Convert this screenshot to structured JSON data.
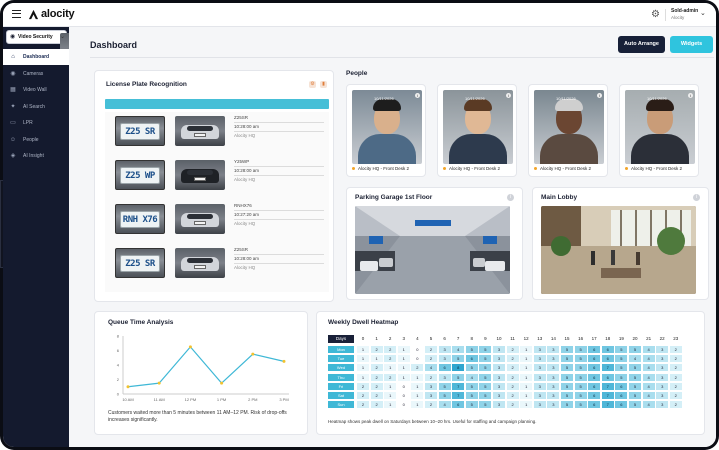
{
  "app": {
    "brand": "alocity"
  },
  "user": {
    "name": "Sold-admin",
    "org": "Alocity"
  },
  "workspace": {
    "label": "Video Security"
  },
  "nav": [
    {
      "label": "Dashboard",
      "icon": "home-icon",
      "glyph": "⌂",
      "active": true
    },
    {
      "label": "Cameras",
      "icon": "camera-icon",
      "glyph": "◉",
      "active": false
    },
    {
      "label": "Video Wall",
      "icon": "grid-icon",
      "glyph": "▦",
      "active": false
    },
    {
      "label": "AI Search",
      "icon": "sparkle-search-icon",
      "glyph": "✦",
      "active": false
    },
    {
      "label": "LPR",
      "icon": "car-icon",
      "glyph": "▭",
      "active": false
    },
    {
      "label": "People",
      "icon": "people-icon",
      "glyph": "☺",
      "active": false
    },
    {
      "label": "AI Insight",
      "icon": "insight-icon",
      "glyph": "◈",
      "active": false
    }
  ],
  "header": {
    "title": "Dashboard",
    "auto_arrange": "Auto Arrange",
    "widgets": "Widgets"
  },
  "lpr": {
    "title": "License Plate Recognition",
    "rows": [
      {
        "plate": "Z25 SR",
        "value": "Z25SR",
        "time": "10:28:00 am",
        "site": "Alocity HQ",
        "car": "light"
      },
      {
        "plate": "Z25 WP",
        "value": "Y25WP",
        "time": "10:28:00 am",
        "site": "Alocity HQ",
        "car": "dark"
      },
      {
        "plate": "RNH X76",
        "value": "RNHX76",
        "time": "10:27:20 am",
        "site": "Alocity HQ",
        "car": "light"
      },
      {
        "plate": "Z25 SR",
        "value": "Z25SR",
        "time": "10:28:00 am",
        "site": "Alocity HQ",
        "car": "light"
      }
    ]
  },
  "people": {
    "title": "People",
    "cards": [
      {
        "timestamp": "10/11/2026",
        "label": "Alocity HQ - Front Desk 2",
        "bg": "#7c8a96",
        "skin": "#d9b08c",
        "hair": "#1d1d1d",
        "shirt": "#4d6a86"
      },
      {
        "timestamp": "10/11/2026",
        "label": "Alocity HQ - Front Desk 2",
        "bg": "#8b949a",
        "skin": "#e0b895",
        "hair": "#5a3a24",
        "shirt": "#2d3a4d"
      },
      {
        "timestamp": "10/11/2026",
        "label": "Alocity HQ - Front Desk 2",
        "bg": "#7a8790",
        "skin": "#6b4632",
        "hair": "#cfcfcf",
        "shirt": "#5a4a40"
      },
      {
        "timestamp": "10/11/2026",
        "label": "Alocity HQ - Front Desk 2",
        "bg": "#a6adb0",
        "skin": "#c99c78",
        "hair": "#2a1d17",
        "shirt": "#2b2f38"
      }
    ]
  },
  "cameras": [
    {
      "title": "Parking Garage 1st Floor"
    },
    {
      "title": "Main Lobby"
    }
  ],
  "queue": {
    "title": "Queue Time Analysis",
    "note": "Customers waited more than 5 minutes between 11 AM–12 PM. Risk of drop-offs increases significantly.",
    "chart_data": {
      "type": "line",
      "categories": [
        "10 AM",
        "11 AM",
        "12 PM",
        "1 PM",
        "2 PM",
        "3 PM"
      ],
      "values": [
        1,
        1.5,
        6.5,
        1.5,
        5.5,
        4.5
      ],
      "yticks": [
        "0",
        "2",
        "4",
        "6",
        "8"
      ],
      "ylim": [
        0,
        8
      ],
      "color": "#3fb8d6"
    }
  },
  "heatmap": {
    "title": "Weekly Dwell Heatmap",
    "days_label": "Days",
    "hours": [
      "0",
      "1",
      "2",
      "3",
      "4",
      "5",
      "6",
      "7",
      "8",
      "9",
      "10",
      "11",
      "12",
      "13",
      "14",
      "15",
      "16",
      "17",
      "18",
      "19",
      "20",
      "21",
      "22",
      "23"
    ],
    "note": "Heatmap shows peak dwell on Saturdays between 10–20 hrs. Useful for staffing and campaign planning.",
    "chart_data": {
      "type": "heatmap",
      "rows": [
        "Mon",
        "Tue",
        "Wed",
        "Thu",
        "Fri",
        "Sat",
        "Sun"
      ],
      "values": [
        [
          1,
          2,
          2,
          1,
          0,
          2,
          3,
          4,
          5,
          5,
          3,
          2,
          1,
          3,
          3,
          5,
          5,
          6,
          6,
          5,
          5,
          4,
          3,
          2
        ],
        [
          1,
          1,
          2,
          1,
          0,
          2,
          3,
          5,
          6,
          5,
          3,
          2,
          1,
          3,
          3,
          5,
          5,
          6,
          6,
          5,
          4,
          4,
          3,
          2
        ],
        [
          1,
          2,
          1,
          1,
          2,
          4,
          6,
          8,
          5,
          5,
          3,
          2,
          1,
          3,
          3,
          5,
          5,
          6,
          7,
          5,
          5,
          4,
          3,
          2
        ],
        [
          1,
          2,
          2,
          1,
          1,
          2,
          3,
          5,
          4,
          5,
          3,
          2,
          1,
          3,
          3,
          5,
          5,
          6,
          6,
          5,
          5,
          4,
          3,
          2
        ],
        [
          2,
          2,
          1,
          0,
          1,
          3,
          5,
          7,
          5,
          5,
          3,
          2,
          1,
          3,
          3,
          5,
          5,
          6,
          7,
          6,
          5,
          4,
          3,
          2
        ],
        [
          2,
          2,
          1,
          0,
          1,
          3,
          5,
          7,
          5,
          5,
          3,
          2,
          1,
          3,
          3,
          5,
          5,
          6,
          7,
          6,
          5,
          4,
          3,
          2
        ],
        [
          2,
          2,
          1,
          0,
          1,
          2,
          4,
          6,
          5,
          5,
          3,
          2,
          1,
          3,
          3,
          5,
          5,
          6,
          7,
          6,
          5,
          4,
          3,
          2
        ]
      ]
    }
  },
  "colors": {
    "accent": "#2fc4de",
    "navy": "#172038",
    "sidebar": "#141a2e"
  }
}
